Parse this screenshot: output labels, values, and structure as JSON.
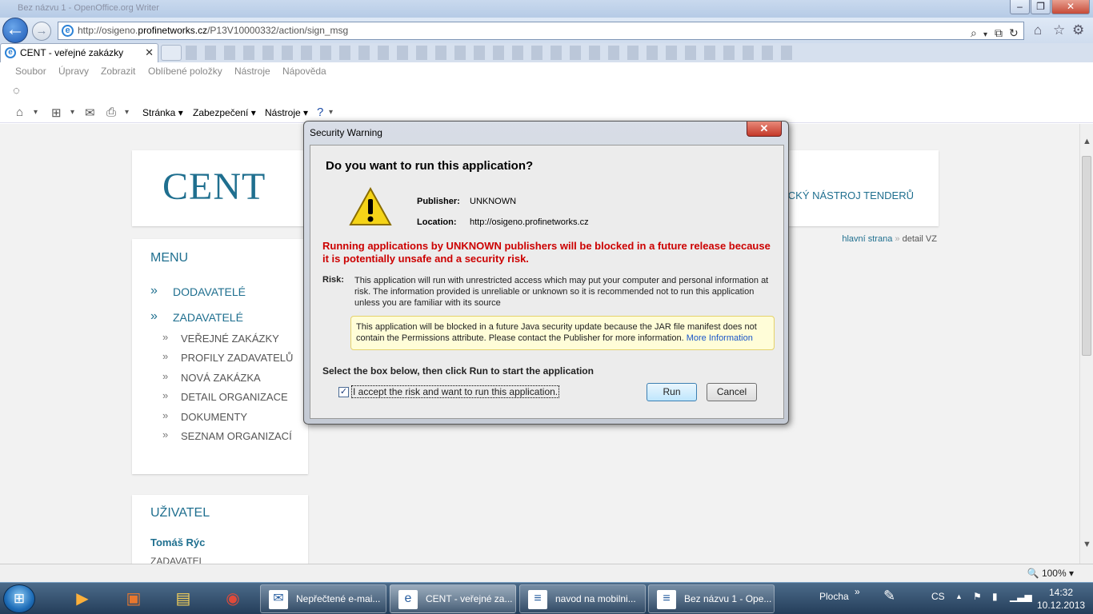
{
  "browser": {
    "window_title": "Bez názvu 1 - OpenOffice.org Writer",
    "address": {
      "prefix": "http://osigeno.",
      "domain": "profinetworks.cz",
      "path": "/P13V10000332/action/sign_msg"
    },
    "tab": {
      "title": "CENT - veřejné zakázky",
      "close": "✕"
    },
    "menu": [
      "Soubor",
      "Úpravy",
      "Zobrazit",
      "Oblíbené položky",
      "Nástroje",
      "Nápověda"
    ],
    "commands": {
      "page": "Stránka ▾",
      "security": "Zabezpečení ▾",
      "tools": "Nástroje ▾"
    },
    "zoom": "100%"
  },
  "site": {
    "logo": "CENT",
    "tagline": "CKÝ NÁSTROJ TENDERŮ",
    "breadcrumb": {
      "home": "hlavní strana",
      "sep": "»",
      "current": "detail VZ"
    },
    "menu": {
      "title": "MENU",
      "items": [
        "DODAVATELÉ",
        "ZADAVATELÉ"
      ],
      "subitems": [
        "VEŘEJNÉ ZAKÁZKY",
        "PROFILY ZADAVATELŮ",
        "NOVÁ ZAKÁZKA",
        "DETAIL ORGANIZACE",
        "DOKUMENTY",
        "SEZNAM ORGANIZACÍ"
      ]
    },
    "user": {
      "title": "UŽIVATEL",
      "name": "Tomáš Rýc",
      "role": "ZADAVATEL"
    }
  },
  "dialog": {
    "title": "Security Warning",
    "question": "Do you want to run this application?",
    "publisher_label": "Publisher:",
    "publisher": "UNKNOWN",
    "location_label": "Location:",
    "location": "http://osigeno.profinetworks.cz",
    "red_warning": "Running applications by UNKNOWN publishers will be blocked in a future release because it is potentially unsafe and a security risk.",
    "risk_label": "Risk:",
    "risk_text": "This application will run with unrestricted access which may put your computer and personal information at risk. The information provided is unreliable or unknown so it is recommended not to run this application unless you are familiar with its source",
    "notice_text": "This application will be blocked in a future Java security update because the JAR file manifest does not contain the Permissions attribute. Please contact the Publisher for more information.",
    "notice_link": "More Information",
    "instruction": "Select the box below, then click Run to start the application",
    "checkbox_label": "I accept the risk and want to run this application.",
    "checkbox_checked": true,
    "run": "Run",
    "cancel": "Cancel"
  },
  "taskbar": {
    "buttons": [
      "Nepřečtené e-mai...",
      "CENT - veřejné za...",
      "navod na mobilni...",
      "Bez názvu 1 - Ope..."
    ],
    "desktop": "Plocha",
    "lang": "CS",
    "time": "14:32",
    "date": "10.12.2013"
  }
}
